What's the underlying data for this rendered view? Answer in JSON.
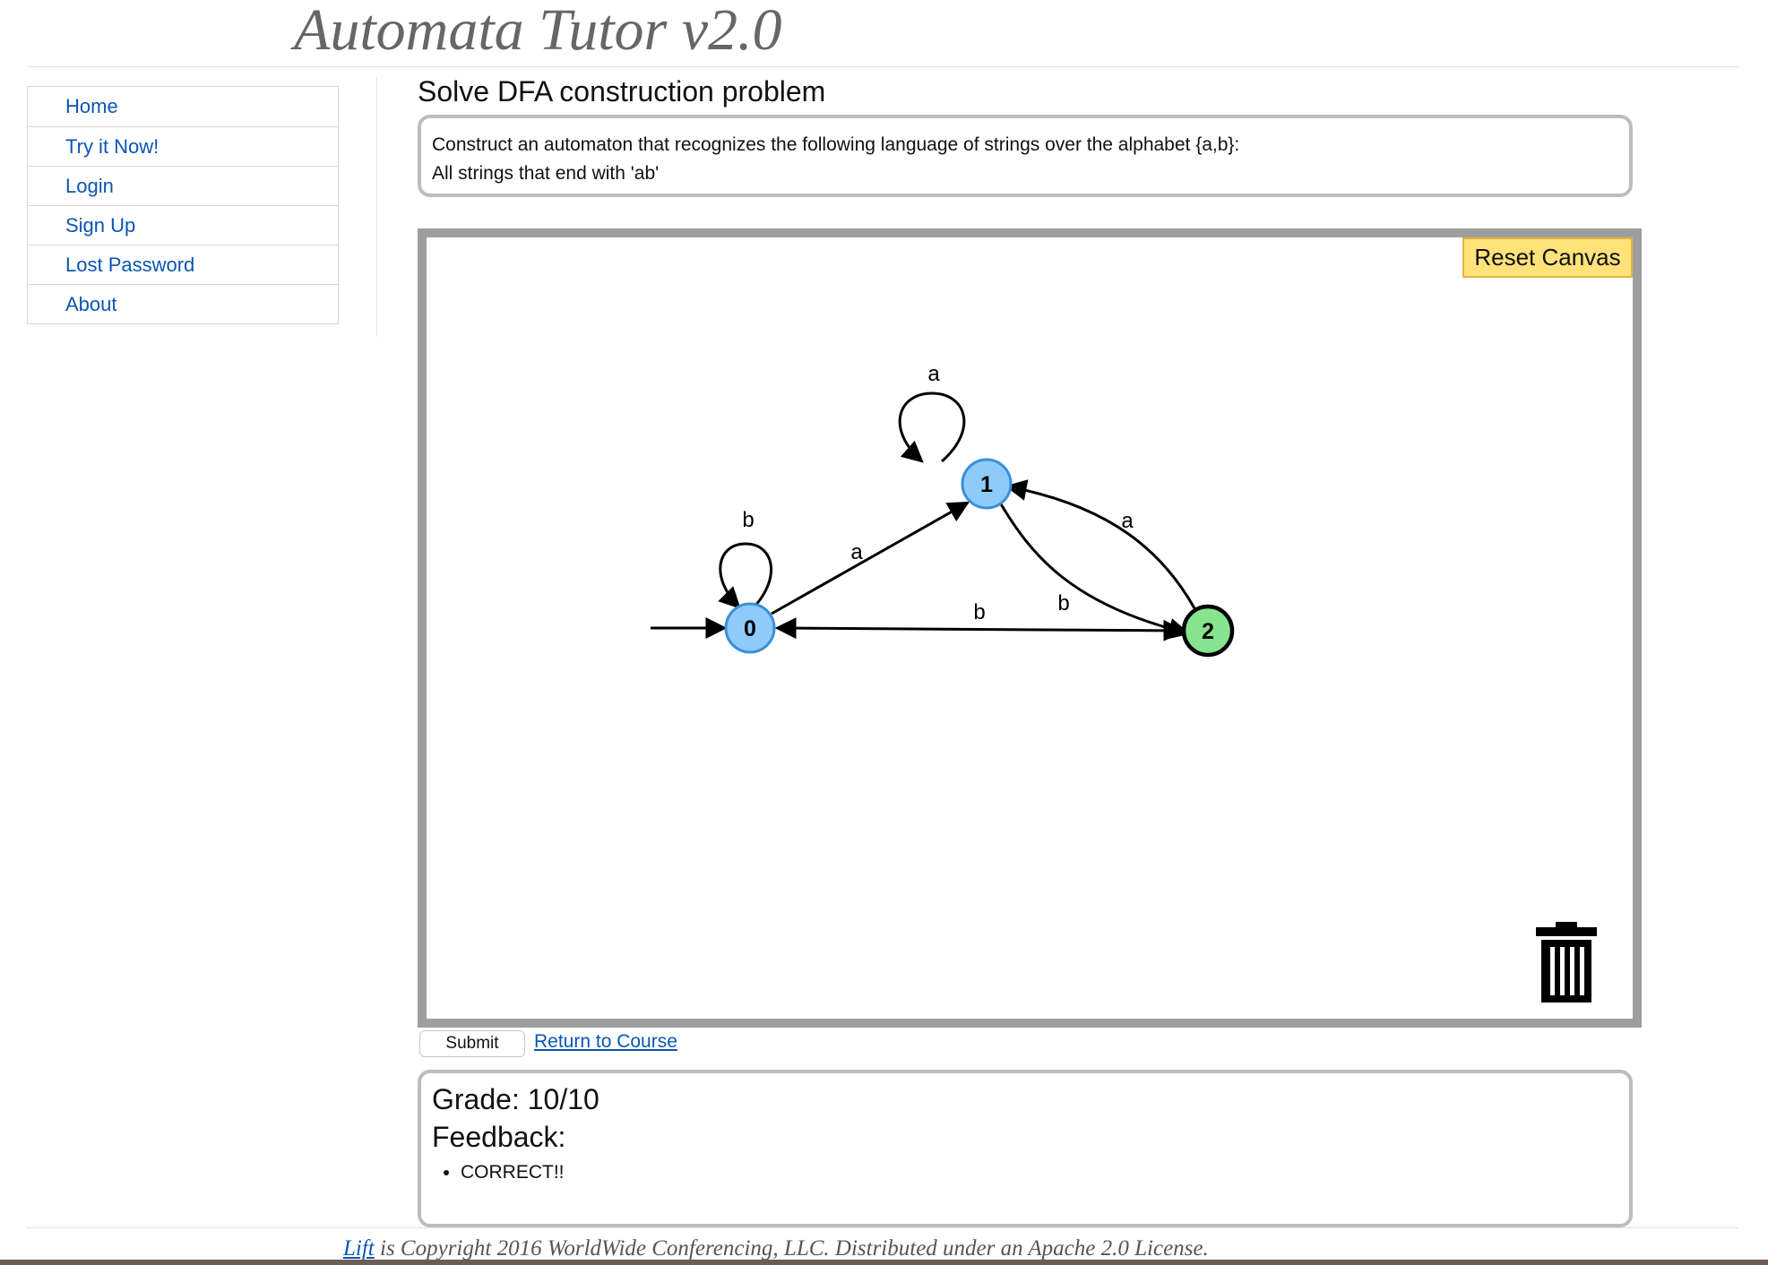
{
  "app_title": "Automata Tutor v2.0",
  "nav": {
    "items": [
      {
        "label": "Home"
      },
      {
        "label": "Try it Now!"
      },
      {
        "label": "Login"
      },
      {
        "label": "Sign Up"
      },
      {
        "label": "Lost Password"
      },
      {
        "label": "About"
      }
    ]
  },
  "page": {
    "title": "Solve DFA construction problem",
    "problem": {
      "line1": "Construct an automaton that recognizes the following language of strings over the alphabet {a,b}:",
      "line2": "All strings that end with 'ab'"
    }
  },
  "canvas": {
    "reset_label": "Reset Canvas",
    "trash_icon": "trash-icon",
    "states": [
      {
        "id": "s0",
        "label": "0",
        "accepting": false,
        "initial": true
      },
      {
        "id": "s1",
        "label": "1",
        "accepting": false,
        "initial": false
      },
      {
        "id": "s2",
        "label": "2",
        "accepting": true,
        "initial": false
      }
    ],
    "transitions": [
      {
        "from": "0",
        "to": "0",
        "label": "b"
      },
      {
        "from": "0",
        "to": "1",
        "label": "a"
      },
      {
        "from": "1",
        "to": "1",
        "label": "a"
      },
      {
        "from": "1",
        "to": "2",
        "label": "b"
      },
      {
        "from": "2",
        "to": "1",
        "label": "a"
      },
      {
        "from": "2",
        "to": "0",
        "label": "b"
      }
    ],
    "colors": {
      "state_fill": "#8ecbfb",
      "state_stroke": "#3a8fd8",
      "accepting_fill": "#86e48f",
      "accepting_stroke": "#000000"
    }
  },
  "actions": {
    "submit_label": "Submit",
    "return_label": "Return to Course"
  },
  "result": {
    "grade": "Grade: 10/10",
    "feedback_label": "Feedback:",
    "feedback_items": [
      "CORRECT!!"
    ]
  },
  "footer": {
    "link_label": "Lift",
    "text": " is Copyright 2016 WorldWide Conferencing, LLC. Distributed under an Apache 2.0 License."
  }
}
